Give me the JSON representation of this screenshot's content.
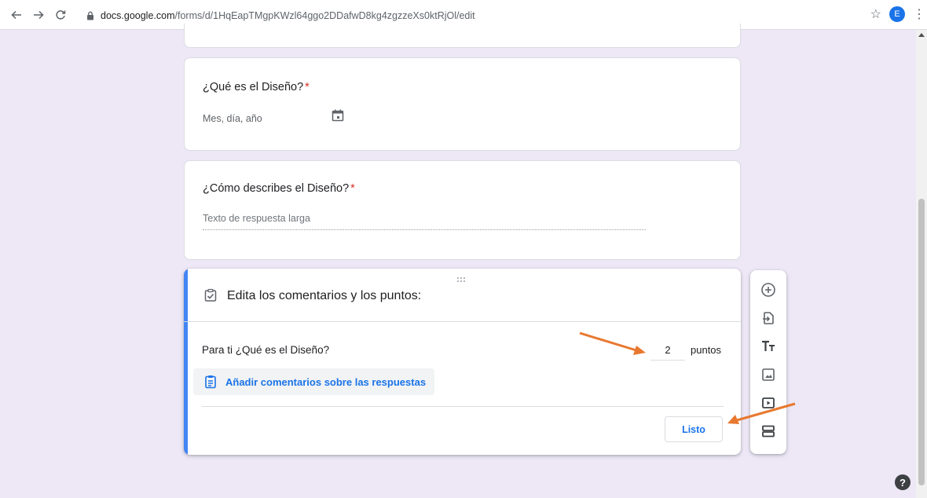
{
  "browser": {
    "url_host": "docs.google.com",
    "url_path": "/forms/d/1HqEapTMgpKWzl64ggo2DDafwD8kg4zgzzeXs0ktRjOl/edit",
    "profile_initial": "E",
    "icons": [
      "back-icon",
      "forward-icon",
      "reload-icon",
      "lock-icon",
      "star-icon",
      "menu-icon"
    ]
  },
  "questions": [
    {
      "title": "¿Qué es el Diseño?",
      "required_mark": "*",
      "placeholder": "Mes, día, año",
      "icon": "calendar-icon"
    },
    {
      "title": "¿Cómo describes el Diseño?",
      "required_mark": "*",
      "placeholder": "Texto de respuesta larga"
    }
  ],
  "feedback_card": {
    "heading": "Edita los comentarios y los puntos:",
    "question_label": "Para ti ¿Qué es el Diseño?",
    "points_value": "2",
    "points_unit": "puntos",
    "add_feedback_label": "Añadir comentarios sobre las respuestas",
    "done_label": "Listo",
    "accent_color": "#4285f4"
  },
  "toolbar": {
    "items": [
      "add-question-icon",
      "import-questions-icon",
      "add-title-icon",
      "add-image-icon",
      "add-video-icon",
      "add-section-icon"
    ]
  },
  "colors": {
    "background": "#ede7f6",
    "arrow": "#e8782f",
    "link": "#1a73e8",
    "required": "#d93025"
  }
}
